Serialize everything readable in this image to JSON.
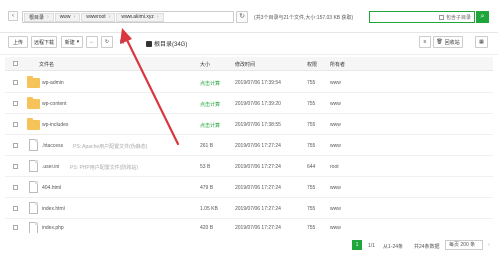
{
  "path": {
    "back_icon": "left-arrow-icon",
    "crumbs": [
      "根目录",
      "www",
      "wwwroot",
      "www.akimi.xyz"
    ],
    "stats": "(共3个目录与21个文件,大小:157.03 KB 获取)"
  },
  "search": {
    "placeholder": "",
    "include_sub": "包含子目录",
    "icon": "search-icon"
  },
  "toolbar": {
    "upload": "上传",
    "remote_download": "远程下载",
    "new": "新建",
    "disk": "根目录(34G)",
    "recycle_bin": "回收站"
  },
  "table": {
    "headers": [
      "文件名",
      "大小",
      "修改时间",
      "权限",
      "所有者"
    ],
    "rows": [
      {
        "name": "wp-admin",
        "note": "",
        "size": "点击计算",
        "time": "2019/07/06 17:39:54",
        "perm": "755",
        "owner": "www",
        "type": "folder"
      },
      {
        "name": "wp-content",
        "note": "",
        "size": "点击计算",
        "time": "2019/07/06 17:39:20",
        "perm": "755",
        "owner": "www",
        "type": "folder"
      },
      {
        "name": "wp-includes",
        "note": "",
        "size": "点击计算",
        "time": "2019/07/06 17:38:55",
        "perm": "755",
        "owner": "www",
        "type": "folder"
      },
      {
        "name": ".htaccess",
        "note": "PS: Apache用户配置文件(伪静态)",
        "size": "261 B",
        "time": "2019/07/06 17:27:24",
        "perm": "755",
        "owner": "www",
        "type": "file"
      },
      {
        "name": ".user.ini",
        "note": "PS: PHP用户配置文件(防跨站)",
        "size": "53 B",
        "time": "2019/07/06 17:27:24",
        "perm": "644",
        "owner": "root",
        "type": "file"
      },
      {
        "name": "404.html",
        "note": "",
        "size": "479 B",
        "time": "2019/07/06 17:27:24",
        "perm": "755",
        "owner": "www",
        "type": "file"
      },
      {
        "name": "index.html",
        "note": "",
        "size": "1.05 KB",
        "time": "2019/07/06 17:27:24",
        "perm": "755",
        "owner": "www",
        "type": "file"
      },
      {
        "name": "index.php",
        "note": "",
        "size": "420 B",
        "time": "2019/07/06 17:27:24",
        "perm": "755",
        "owner": "www",
        "type": "file"
      }
    ]
  },
  "pager": {
    "current": "1",
    "page_of": "1/1",
    "range": "从1-24条",
    "total": "共24条数据",
    "per_page": "每页 200 条"
  },
  "colors": {
    "accent": "#20a53a",
    "folder": "#f6c35b",
    "annotation_arrow": "#d9363e"
  }
}
